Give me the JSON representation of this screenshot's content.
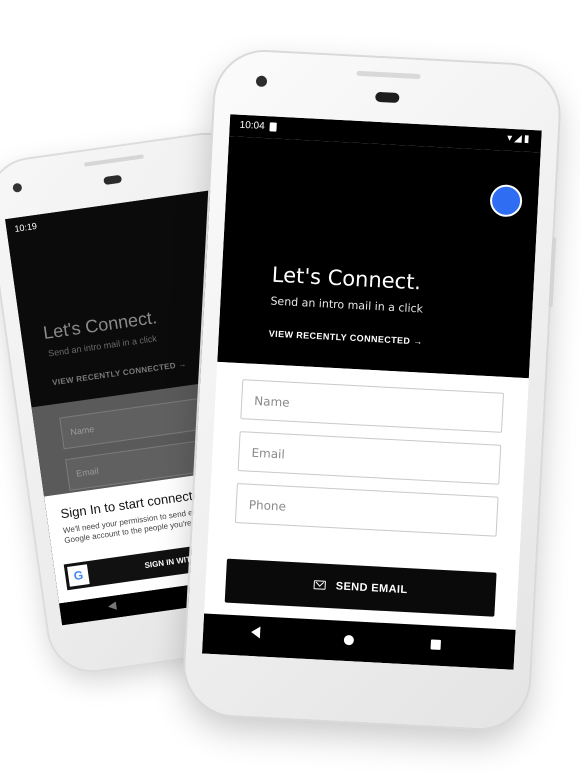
{
  "back_phone": {
    "status": {
      "time": "10:19"
    },
    "hero": {
      "title": "Let's Connect.",
      "subtitle": "Send an intro mail in a click",
      "link": "VIEW RECENTLY CONNECTED →"
    },
    "form": {
      "name_placeholder": "Name",
      "email_placeholder": "Email"
    },
    "sheet": {
      "title": "Sign In to start connecting",
      "description": "We'll need your permission to send emails from your Google account to the people you're connecting with.",
      "google_logo_text": "G",
      "google_button_label": "SIGN IN WITH GOOGLE"
    },
    "nav": {
      "back_icon": "◀"
    }
  },
  "front_phone": {
    "status": {
      "time": "10:04",
      "icons": "▾◢▮"
    },
    "hero": {
      "title": "Let's Connect.",
      "subtitle": "Send an intro mail in a click",
      "link": "VIEW RECENTLY CONNECTED →",
      "avatar_color": "#2f6ef2"
    },
    "form": {
      "name_placeholder": "Name",
      "email_placeholder": "Email",
      "phone_placeholder": "Phone",
      "send_button_label": "SEND EMAIL"
    }
  }
}
